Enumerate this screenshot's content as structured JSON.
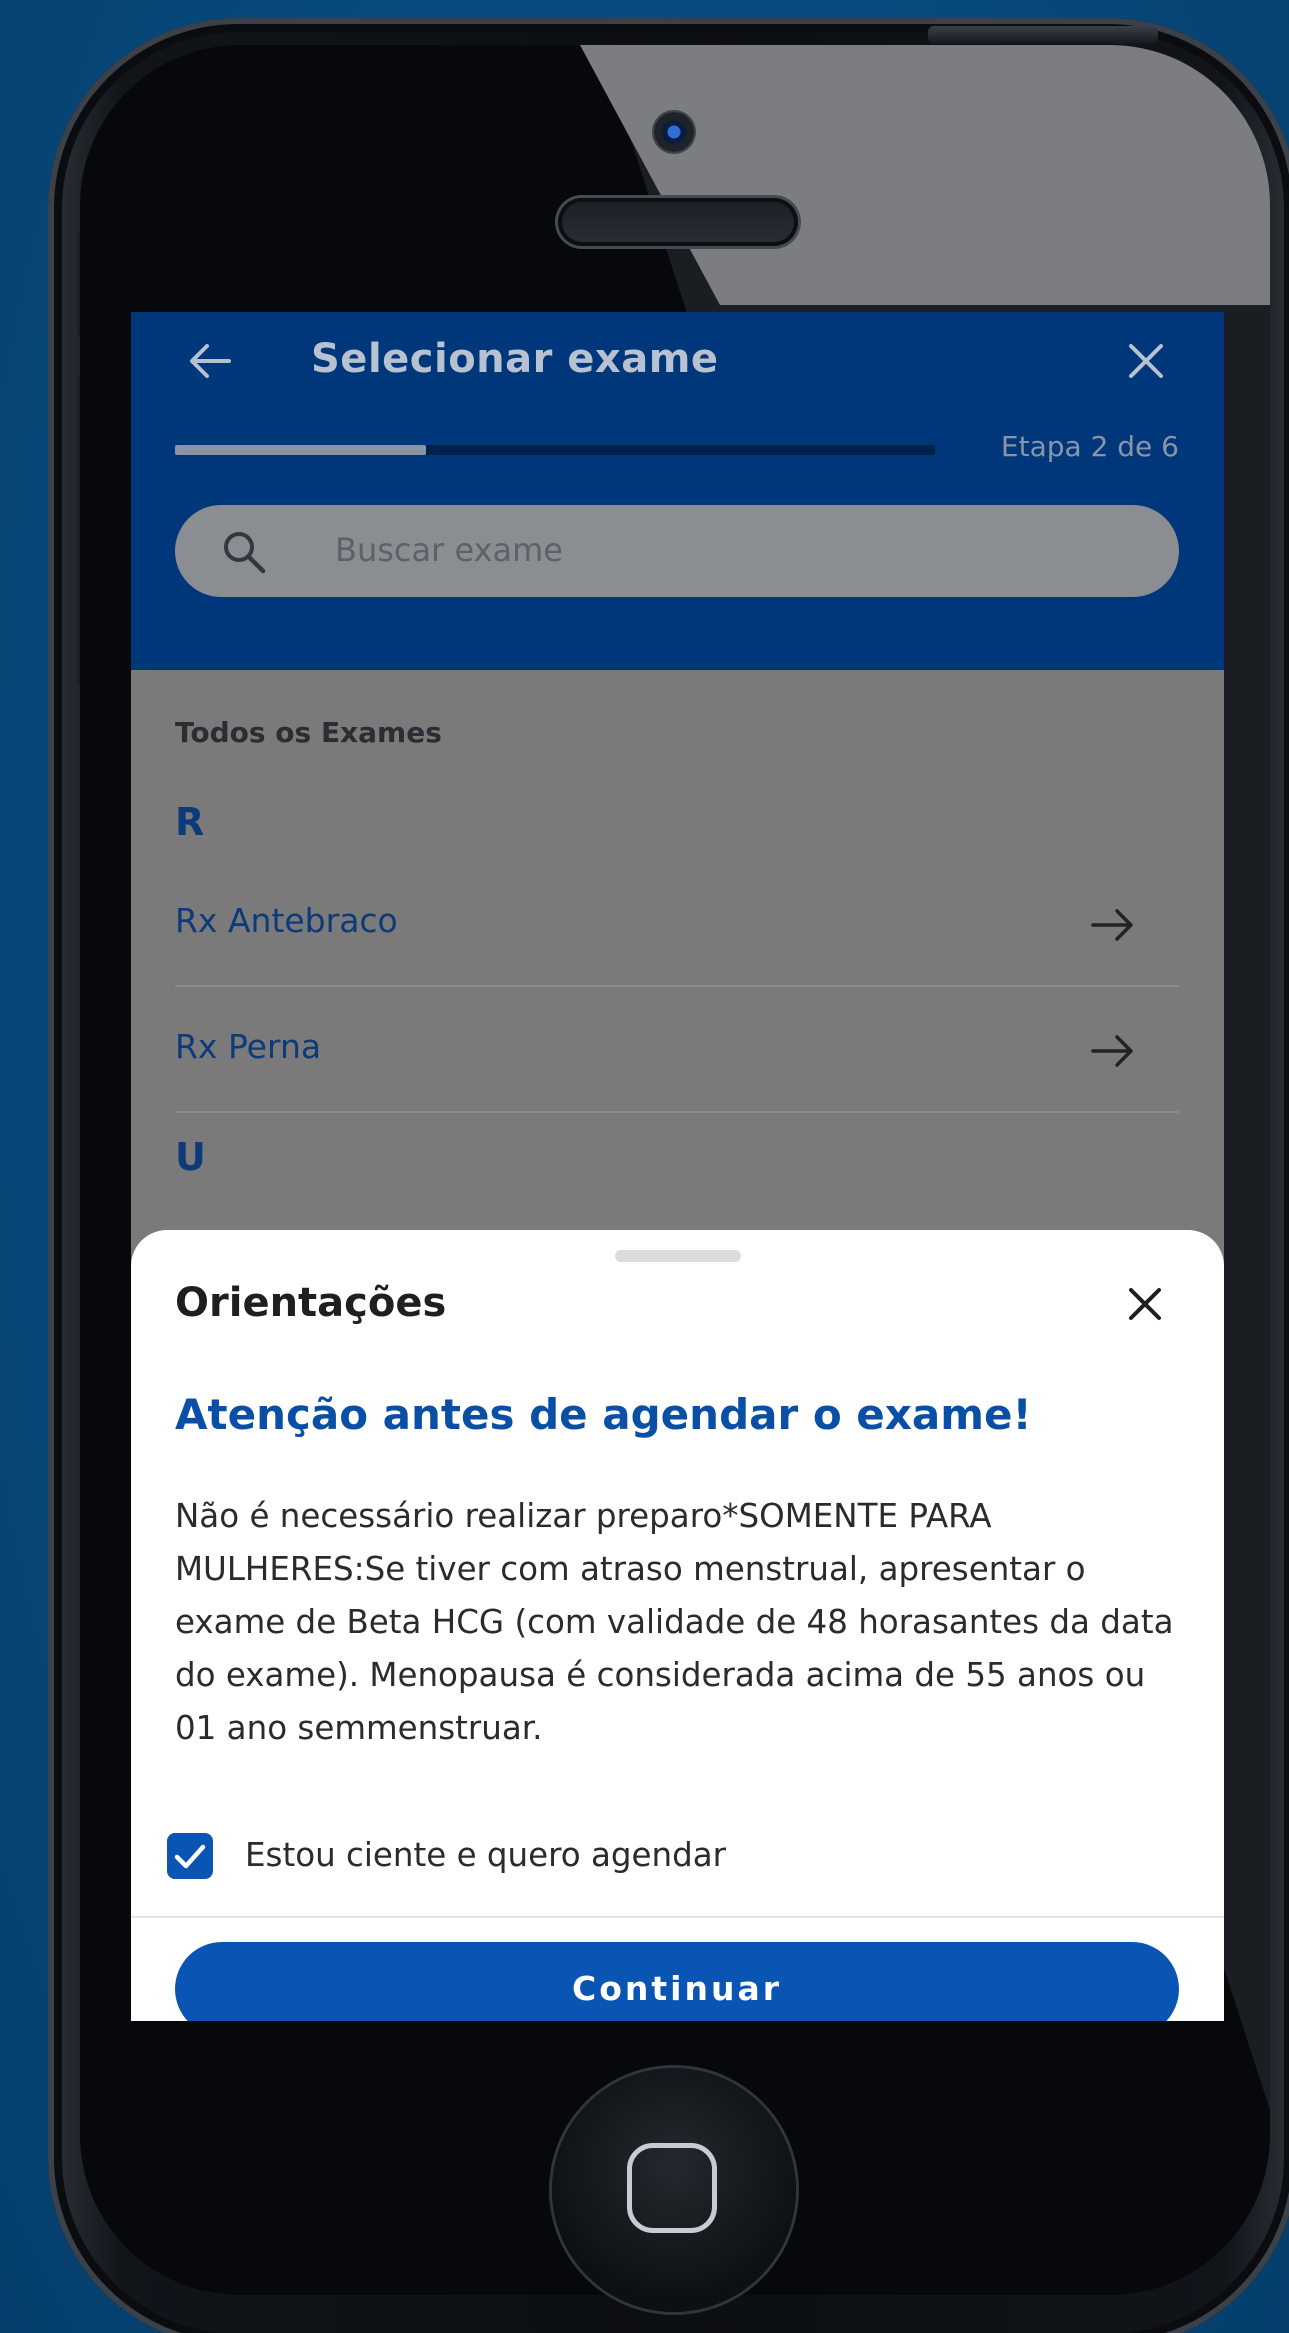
{
  "header": {
    "title": "Selecionar exame",
    "step": "Etapa 2 de 6",
    "progress_fraction": 0.33
  },
  "search": {
    "placeholder": "Buscar exame"
  },
  "list": {
    "caption": "Todos os Exames",
    "groups": [
      {
        "letter": "R",
        "items": [
          {
            "label": "Rx Antebraco"
          },
          {
            "label": "Rx Perna"
          }
        ]
      },
      {
        "letter": "U",
        "items": []
      }
    ]
  },
  "sheet": {
    "title": "Orientações",
    "heading": "Atenção antes de agendar o exame!",
    "body": "Não é necessário realizar preparo*SOMENTE PARA MULHERES:Se tiver com atraso menstrual, apresentar o exame de Beta HCG (com validade de 48 horasantes da data do exame). Menopausa é considerada acima de 55 anos ou 01 ano semmenstruar.",
    "consent_label": "Estou ciente e quero agendar",
    "consent_checked": true,
    "continue_label": "Continuar"
  },
  "colors": {
    "primary": "#0a55b4",
    "header_bg": "#00377a",
    "background": "#064a7e"
  },
  "icons": {
    "back": "arrow-left-icon",
    "close": "close-icon",
    "search": "search-icon",
    "row_arrow": "arrow-right-icon",
    "checkbox": "check-icon",
    "home": "home-button-icon"
  }
}
